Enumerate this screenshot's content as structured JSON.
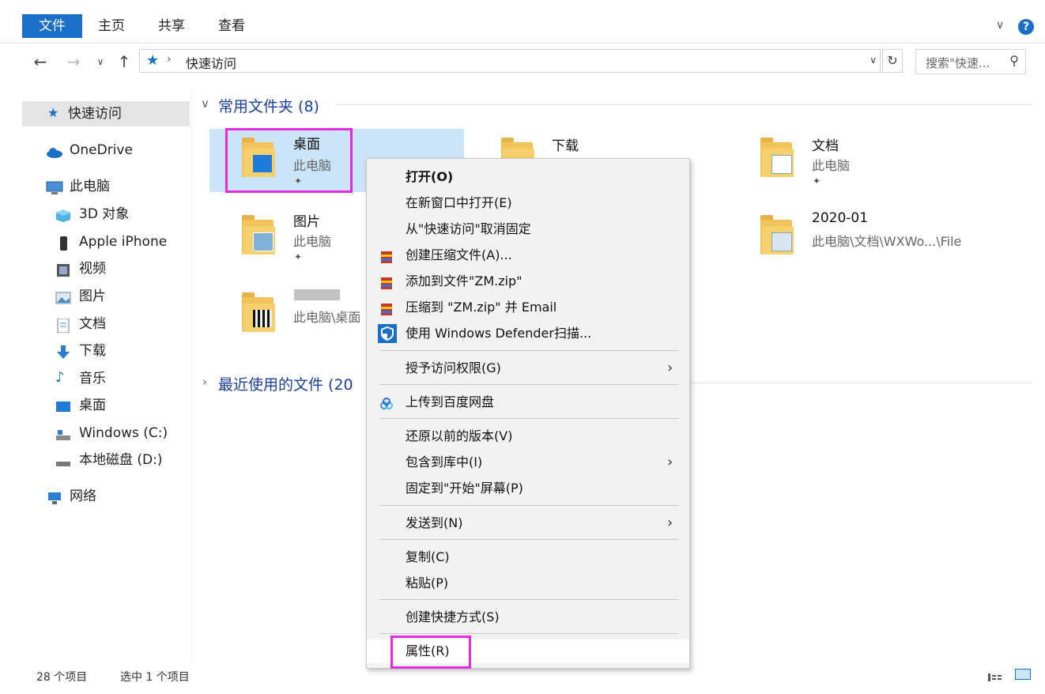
{
  "ribbon": {
    "tabs": [
      "文件",
      "主页",
      "共享",
      "查看"
    ],
    "help": "?"
  },
  "address": {
    "path_label": "快速访问",
    "search_placeholder": "搜索\"快速...",
    "search_icon": "search-icon"
  },
  "sidebar": {
    "items": [
      "快速访问",
      "OneDrive",
      "此电脑",
      "3D 对象",
      "Apple iPhone",
      "视频",
      "图片",
      "文档",
      "下载",
      "音乐",
      "桌面",
      "Windows (C:)",
      "本地磁盘 (D:)",
      "网络"
    ]
  },
  "main": {
    "group1_title": "常用文件夹 (8)",
    "group2_title": "最近使用的文件 (20",
    "tiles": [
      {
        "name": "桌面",
        "sub": "此电脑"
      },
      {
        "name": "下载",
        "sub": ""
      },
      {
        "name": "文档",
        "sub": "此电脑"
      },
      {
        "name": "图片",
        "sub": "此电脑"
      },
      {
        "name": "2020-01",
        "sub": "此电脑\\文档\\WXWo...\\File"
      },
      {
        "name": "",
        "sub": "此电脑\\桌面"
      }
    ]
  },
  "context_menu": {
    "items": [
      "打开(O)",
      "在新窗口中打开(E)",
      "从\"快速访问\"取消固定",
      "创建压缩文件(A)...",
      "添加到文件\"ZM.zip\"",
      "压缩到 \"ZM.zip\" 并 Email",
      "使用 Windows Defender扫描...",
      "授予访问权限(G)",
      "上传到百度网盘",
      "还原以前的版本(V)",
      "包含到库中(I)",
      "固定到\"开始\"屏幕(P)",
      "发送到(N)",
      "复制(C)",
      "粘贴(P)",
      "创建快捷方式(S)",
      "属性(R)"
    ]
  },
  "status": {
    "count": "28 个项目",
    "selected": "选中 1 个项目"
  },
  "colors": {
    "accent": "#1a6fc7",
    "highlight": "#e52ae0",
    "selection": "#cce4f7"
  }
}
